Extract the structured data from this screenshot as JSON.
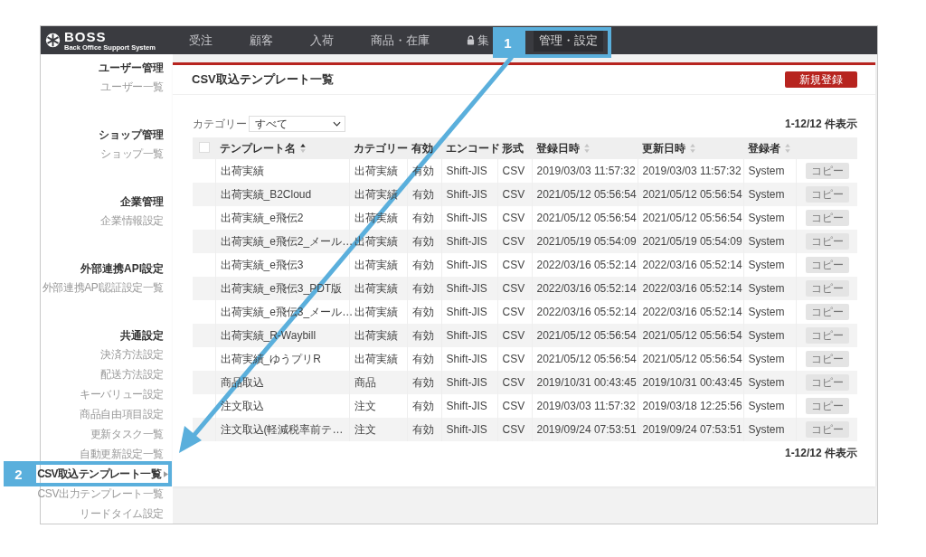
{
  "header": {
    "logo": "BOSS",
    "tagline": "Back Office Support System",
    "nav": [
      {
        "label": "受注",
        "selected": false,
        "locked": false
      },
      {
        "label": "顧客",
        "selected": false,
        "locked": false
      },
      {
        "label": "入荷",
        "selected": false,
        "locked": false
      },
      {
        "label": "商品・在庫",
        "selected": false,
        "locked": false
      },
      {
        "label": "集",
        "selected": false,
        "locked": true
      },
      {
        "label": "管理・設定",
        "selected": true,
        "locked": false
      }
    ]
  },
  "sidebar": {
    "groups": [
      {
        "title": "ユーザー管理",
        "items": [
          {
            "label": "ユーザー一覧",
            "selected": false
          }
        ]
      },
      {
        "title": "ショップ管理",
        "items": [
          {
            "label": "ショップ一覧",
            "selected": false
          }
        ]
      },
      {
        "title": "企業管理",
        "items": [
          {
            "label": "企業情報設定",
            "selected": false
          }
        ]
      },
      {
        "title": "外部連携API設定",
        "items": [
          {
            "label": "外部連携API認証設定一覧",
            "selected": false
          }
        ]
      },
      {
        "title": "共通設定",
        "items": [
          {
            "label": "決済方法設定",
            "selected": false
          },
          {
            "label": "配送方法設定",
            "selected": false
          },
          {
            "label": "キーバリュー設定",
            "selected": false
          },
          {
            "label": "商品自由項目設定",
            "selected": false
          },
          {
            "label": "更新タスク一覧",
            "selected": false
          },
          {
            "label": "自動更新設定一覧",
            "selected": false
          },
          {
            "label": "CSV取込テンプレート一覧",
            "selected": true
          },
          {
            "label": "CSV出力テンプレート一覧",
            "selected": false
          },
          {
            "label": "リードタイム設定",
            "selected": false
          }
        ]
      }
    ]
  },
  "page": {
    "title": "CSV取込テンプレート一覧",
    "new_button": "新規登録",
    "filter": {
      "label": "カテゴリー",
      "value": "すべて"
    },
    "count_top": "1-12/12 件表示",
    "count_bottom": "1-12/12 件表示",
    "table": {
      "select_all": false,
      "columns": [
        {
          "label": "テンプレート名",
          "sorted": true
        },
        {
          "label": "カテゴリー"
        },
        {
          "label": "有効"
        },
        {
          "label": "エンコード"
        },
        {
          "label": "形式"
        },
        {
          "label": "登録日時",
          "sorted": false
        },
        {
          "label": "更新日時",
          "sorted": false
        },
        {
          "label": "登録者",
          "sorted": false
        }
      ],
      "rows": [
        {
          "cells": [
            "出荷実績",
            "出荷実績",
            "有効",
            "Shift-JIS",
            "CSV",
            "2019/03/03 11:57:32",
            "2019/03/03 11:57:32",
            "System"
          ],
          "button": "コピー"
        },
        {
          "cells": [
            "出荷実績_B2Cloud",
            "出荷実績",
            "有効",
            "Shift-JIS",
            "CSV",
            "2021/05/12 05:56:54",
            "2021/05/12 05:56:54",
            "System"
          ],
          "button": "コピー"
        },
        {
          "cells": [
            "出荷実績_e飛伝2",
            "出荷実績",
            "有効",
            "Shift-JIS",
            "CSV",
            "2021/05/12 05:56:54",
            "2021/05/12 05:56:54",
            "System"
          ],
          "button": "コピー"
        },
        {
          "cells": [
            "出荷実績_e飛伝2_メール…",
            "出荷実績",
            "有効",
            "Shift-JIS",
            "CSV",
            "2021/05/19 05:54:09",
            "2021/05/19 05:54:09",
            "System"
          ],
          "button": "コピー"
        },
        {
          "cells": [
            "出荷実績_e飛伝3",
            "出荷実績",
            "有効",
            "Shift-JIS",
            "CSV",
            "2022/03/16 05:52:14",
            "2022/03/16 05:52:14",
            "System"
          ],
          "button": "コピー"
        },
        {
          "cells": [
            "出荷実績_e飛伝3_PDT版",
            "出荷実績",
            "有効",
            "Shift-JIS",
            "CSV",
            "2022/03/16 05:52:14",
            "2022/03/16 05:52:14",
            "System"
          ],
          "button": "コピー"
        },
        {
          "cells": [
            "出荷実績_e飛伝3_メール…",
            "出荷実績",
            "有効",
            "Shift-JIS",
            "CSV",
            "2022/03/16 05:52:14",
            "2022/03/16 05:52:14",
            "System"
          ],
          "button": "コピー"
        },
        {
          "cells": [
            "出荷実績_R-Waybill",
            "出荷実績",
            "有効",
            "Shift-JIS",
            "CSV",
            "2021/05/12 05:56:54",
            "2021/05/12 05:56:54",
            "System"
          ],
          "button": "コピー"
        },
        {
          "cells": [
            "出荷実績_ゆうプリR",
            "出荷実績",
            "有効",
            "Shift-JIS",
            "CSV",
            "2021/05/12 05:56:54",
            "2021/05/12 05:56:54",
            "System"
          ],
          "button": "コピー"
        },
        {
          "cells": [
            "商品取込",
            "商品",
            "有効",
            "Shift-JIS",
            "CSV",
            "2019/10/31 00:43:45",
            "2019/10/31 00:43:45",
            "System"
          ],
          "button": "コピー"
        },
        {
          "cells": [
            "注文取込",
            "注文",
            "有効",
            "Shift-JIS",
            "CSV",
            "2019/03/03 11:57:32",
            "2019/03/18 12:25:56",
            "System"
          ],
          "button": "コピー"
        },
        {
          "cells": [
            "注文取込(軽減税率前テ…",
            "注文",
            "有効",
            "Shift-JIS",
            "CSV",
            "2019/09/24 07:53:51",
            "2019/09/24 07:53:51",
            "System"
          ],
          "button": "コピー"
        }
      ]
    }
  },
  "annotations": [
    {
      "number": "1"
    },
    {
      "number": "2"
    }
  ]
}
